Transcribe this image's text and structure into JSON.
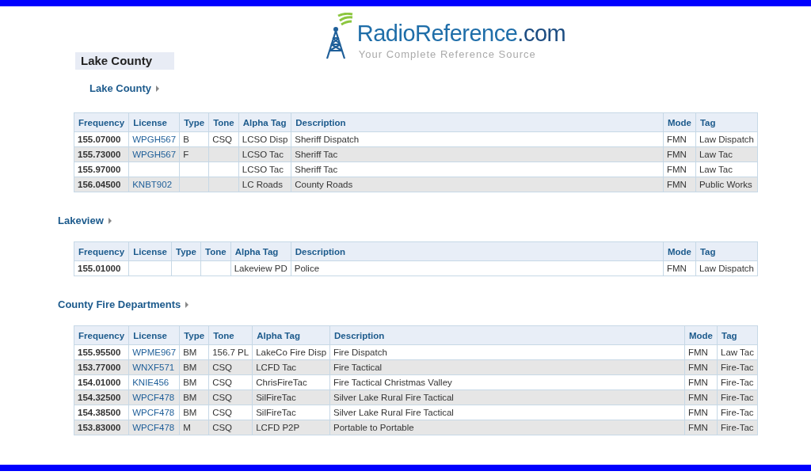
{
  "logo": {
    "brand": "RadioReference",
    "suffix": ".com",
    "tagline": "Your Complete Reference Source"
  },
  "county": {
    "title": "Lake County"
  },
  "sections": [
    {
      "title": "Lake County",
      "kind": "subsection",
      "columns": [
        {
          "label": "Frequency",
          "kind": "frequency"
        },
        {
          "label": "License",
          "kind": "link"
        },
        {
          "label": "Type",
          "kind": "text"
        },
        {
          "label": "Tone",
          "kind": "text"
        },
        {
          "label": "Alpha Tag",
          "kind": "text"
        },
        {
          "label": "Description",
          "kind": "wide"
        },
        {
          "label": "Mode",
          "kind": "text"
        },
        {
          "label": "Tag",
          "kind": "text"
        }
      ],
      "rows": [
        [
          "155.07000",
          "WPGH567",
          "B",
          "CSQ",
          "LCSO Disp",
          "Sheriff Dispatch",
          "FMN",
          "Law Dispatch"
        ],
        [
          "155.73000",
          "WPGH567",
          "F",
          "",
          "LCSO Tac",
          "Sheriff Tac",
          "FMN",
          "Law Tac"
        ],
        [
          "155.97000",
          "",
          "",
          "",
          "LCSO Tac",
          "Sheriff Tac",
          "FMN",
          "Law Tac"
        ],
        [
          "156.04500",
          "KNBT902",
          "",
          "",
          "LC Roads",
          "County Roads",
          "FMN",
          "Public Works"
        ]
      ]
    },
    {
      "title": "Lakeview",
      "kind": "section",
      "columns": [
        {
          "label": "Frequency",
          "kind": "frequency"
        },
        {
          "label": "License",
          "kind": "link"
        },
        {
          "label": "Type",
          "kind": "text"
        },
        {
          "label": "Tone",
          "kind": "text"
        },
        {
          "label": "Alpha Tag",
          "kind": "text"
        },
        {
          "label": "Description",
          "kind": "wide"
        },
        {
          "label": "Mode",
          "kind": "text"
        },
        {
          "label": "Tag",
          "kind": "text"
        }
      ],
      "rows": [
        [
          "155.01000",
          "",
          "",
          "",
          "Lakeview PD",
          "Police",
          "FMN",
          "Law Dispatch"
        ]
      ]
    },
    {
      "title": "County Fire Departments",
      "kind": "section",
      "columns": [
        {
          "label": "Frequency",
          "kind": "frequency"
        },
        {
          "label": "License",
          "kind": "link"
        },
        {
          "label": "Type",
          "kind": "text"
        },
        {
          "label": "Tone",
          "kind": "text"
        },
        {
          "label": "Alpha Tag",
          "kind": "text"
        },
        {
          "label": "Description",
          "kind": "wide"
        },
        {
          "label": "Mode",
          "kind": "text"
        },
        {
          "label": "Tag",
          "kind": "text"
        }
      ],
      "rows": [
        [
          "155.95500",
          "WPME967",
          "BM",
          "156.7 PL",
          "LakeCo Fire Disp",
          "Fire Dispatch",
          "FMN",
          "Law Tac"
        ],
        [
          "153.77000",
          "WNXF571",
          "BM",
          "CSQ",
          "LCFD Tac",
          "Fire Tactical",
          "FMN",
          "Fire-Tac"
        ],
        [
          "154.01000",
          "KNIE456",
          "BM",
          "CSQ",
          "ChrisFireTac",
          "Fire Tactical Christmas Valley",
          "FMN",
          "Fire-Tac"
        ],
        [
          "154.32500",
          "WPCF478",
          "BM",
          "CSQ",
          "SilFireTac",
          "Silver Lake Rural Fire Tactical",
          "FMN",
          "Fire-Tac"
        ],
        [
          "154.38500",
          "WPCF478",
          "BM",
          "CSQ",
          "SilFireTac",
          "Silver Lake Rural Fire Tactical",
          "FMN",
          "Fire-Tac"
        ],
        [
          "153.83000",
          "WPCF478",
          "M",
          "CSQ",
          "LCFD P2P",
          "Portable to Portable",
          "FMN",
          "Fire-Tac"
        ]
      ]
    }
  ]
}
